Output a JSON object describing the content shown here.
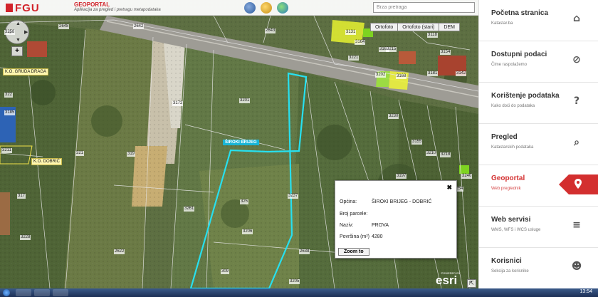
{
  "header": {
    "logo_text": "FGU",
    "app_title": "GEOPORTAL",
    "app_subtitle": "Aplikacija za pregled i pretragu metapodataka",
    "search_placeholder": "Brza pretraga",
    "icons": [
      "layers-icon",
      "user-icon",
      "globe-icon"
    ]
  },
  "basemap_buttons": [
    {
      "label": "Ortofoto"
    },
    {
      "label": "Ortofoto (stari)"
    },
    {
      "label": "DEM"
    }
  ],
  "map": {
    "zoom_label": "+",
    "ko_labels": [
      "K.O. GRUDA DRAGA",
      "K.O. DOBRIĆ"
    ],
    "selected_parcel_label": "ŠIROKI BRIJEG",
    "parcel_labels": [
      "2648",
      "2642",
      "2643",
      "3131",
      "3215",
      "3221",
      "3202",
      "3168",
      "322",
      "3201",
      "3172",
      "3185",
      "321",
      "3211",
      "3261",
      "3237",
      "325",
      "3206",
      "317",
      "319",
      "3205",
      "3230",
      "3155",
      "3210",
      "3197",
      "3218",
      "3228",
      "2638",
      "3258",
      "2622",
      "309",
      "3181",
      "3142",
      "3154",
      "3118",
      "3163",
      "3164",
      "3254",
      "3240"
    ],
    "attribution_small": "POWERED BY",
    "attribution_logo": "esri"
  },
  "popup": {
    "close_label": "✖",
    "rows": [
      {
        "label": "Općina:",
        "value": "ŠIROKI BRIJEG - DOBRIĆ"
      },
      {
        "label": "Broj parcele:",
        "value": ""
      },
      {
        "label": "Naziv:",
        "value": "PROVA"
      },
      {
        "label": "Površina (m²)",
        "value": "4280"
      }
    ],
    "zoom_button": "Zoom to"
  },
  "sidebar": {
    "items": [
      {
        "title": "Početna stranica",
        "subtitle": "Katastar.ba",
        "icon": "home-icon",
        "glyph": "⌂",
        "active": false
      },
      {
        "title": "Dostupni podaci",
        "subtitle": "Čime raspolažemo",
        "icon": "paperclip-icon",
        "glyph": "⊘",
        "active": false
      },
      {
        "title": "Korištenje podataka",
        "subtitle": "Kako doći do podataka",
        "icon": "question-icon",
        "glyph": "?",
        "active": false
      },
      {
        "title": "Pregled",
        "subtitle": "Katastarskih podataka",
        "icon": "search-icon",
        "glyph": "⌕",
        "active": false
      },
      {
        "title": "Geoportal",
        "subtitle": "Web preglednik",
        "icon": "map-pin-icon",
        "glyph": "",
        "active": true
      },
      {
        "title": "Web servisi",
        "subtitle": "WMS, WFS i WCS usluge",
        "icon": "database-icon",
        "glyph": "≡",
        "active": false
      },
      {
        "title": "Korisnici",
        "subtitle": "Sekcija za korisnike",
        "icon": "users-icon",
        "glyph": "☻",
        "active": false
      }
    ],
    "active_color": "#d32f2f"
  },
  "taskbar": {
    "clock": "13:54"
  }
}
